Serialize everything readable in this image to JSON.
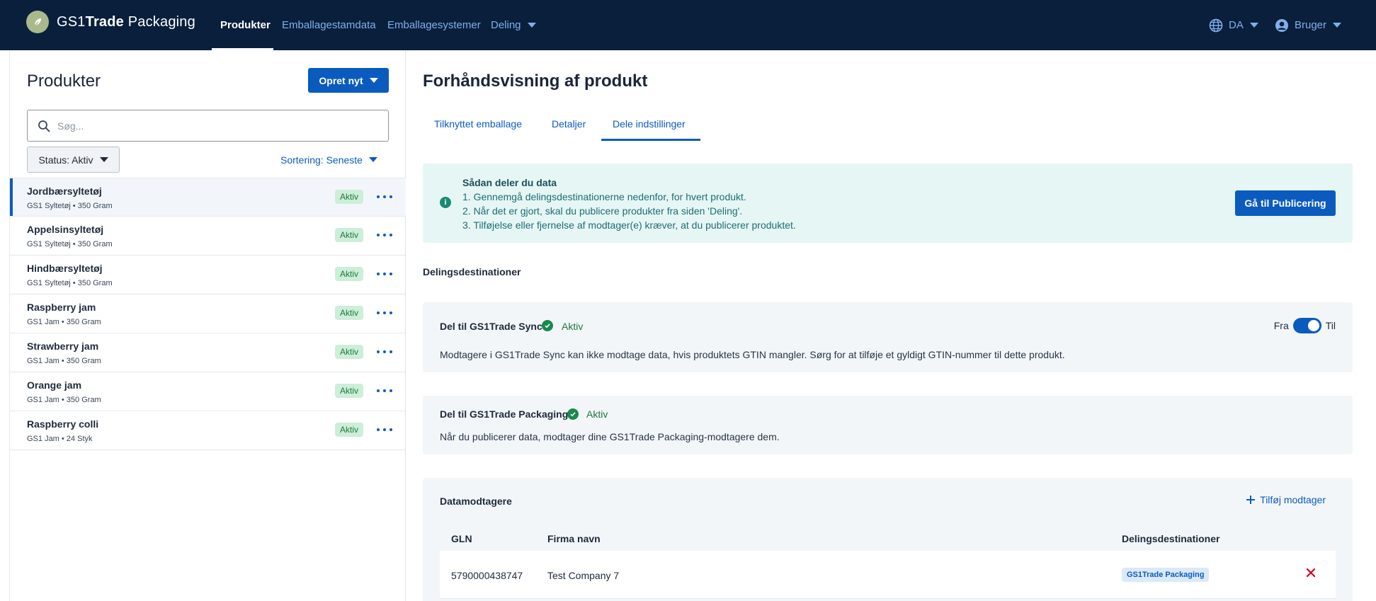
{
  "header": {
    "brand_light_1": "GS1",
    "brand_bold": "Trade",
    "brand_light_2": " Packaging",
    "nav": [
      {
        "label": "Produkter",
        "active": true
      },
      {
        "label": "Emballagestamdata",
        "active": false
      },
      {
        "label": "Emballagesystemer",
        "active": false
      },
      {
        "label": "Deling",
        "active": false
      }
    ],
    "language": "DA",
    "user": "Bruger"
  },
  "left": {
    "title": "Produkter",
    "create_button": "Opret nyt",
    "search_placeholder": "Søg...",
    "status_filter": "Status: Aktiv",
    "sort": "Sortering: Seneste",
    "products": [
      {
        "name": "Jordbærsyltetøj",
        "sub": "GS1 Syltetøj • 350 Gram",
        "status": "Aktiv",
        "selected": true
      },
      {
        "name": "Appelsinsyltetøj",
        "sub": "GS1 Syltetøj • 350 Gram",
        "status": "Aktiv"
      },
      {
        "name": "Hindbærsyltetøj",
        "sub": "GS1 Syltetøj • 350 Gram",
        "status": "Aktiv"
      },
      {
        "name": "Raspberry jam",
        "sub": "GS1 Jam • 350 Gram",
        "status": "Aktiv"
      },
      {
        "name": "Strawberry jam",
        "sub": "GS1 Jam • 350 Gram",
        "status": "Aktiv"
      },
      {
        "name": "Orange jam",
        "sub": "GS1 Jam • 350 Gram",
        "status": "Aktiv"
      },
      {
        "name": "Raspberry colli",
        "sub": "GS1 Jam • 24 Styk",
        "status": "Aktiv"
      }
    ]
  },
  "right": {
    "title": "Forhåndsvisning af produkt",
    "tabs": [
      {
        "label": "Tilknyttet emballage"
      },
      {
        "label": "Detaljer"
      },
      {
        "label": "Dele indstillinger",
        "active": true
      }
    ],
    "info": {
      "title": "Sådan deler du data",
      "lines": [
        "1. Gennemgå delingsdestinationerne nedenfor, for hvert produkt.",
        "2. Når det er gjort, skal du publicere produkter fra siden 'Deling'.",
        "3. Tilføjelse eller fjernelse af modtager(e) kræver, at du publicerer produktet."
      ],
      "button": "Gå til Publicering"
    },
    "section_label": "Delingsdestinationer",
    "sync_card": {
      "title": "Del til GS1Trade Sync",
      "status": "Aktiv",
      "toggle_off_label": "Fra",
      "toggle_on_label": "Til",
      "toggle_on": true,
      "text": "Modtagere i GS1Trade Sync kan ikke modtage data, hvis produktets GTIN mangler. Sørg for at tilføje et gyldigt GTIN-nummer til dette produkt."
    },
    "packaging_card": {
      "title": "Del til GS1Trade Packaging",
      "status": "Aktiv",
      "text": "Når du publicerer data, modtager dine GS1Trade Packaging-modtagere dem."
    },
    "recipients": {
      "title": "Datamodtagere",
      "add_label": "Tilføj modtager",
      "columns": {
        "gln": "GLN",
        "company": "Firma navn",
        "destinations": "Delingsdestinationer"
      },
      "rows": [
        {
          "gln": "5790000438747",
          "company": "Test Company 7",
          "destination": "GS1Trade Packaging"
        }
      ]
    }
  },
  "colors": {
    "nav_bg": "#0a1f3c",
    "primary": "#0b5bbf",
    "success": "#1a8a4b",
    "info_bg": "#e6f6f5",
    "danger": "#d0021b"
  }
}
